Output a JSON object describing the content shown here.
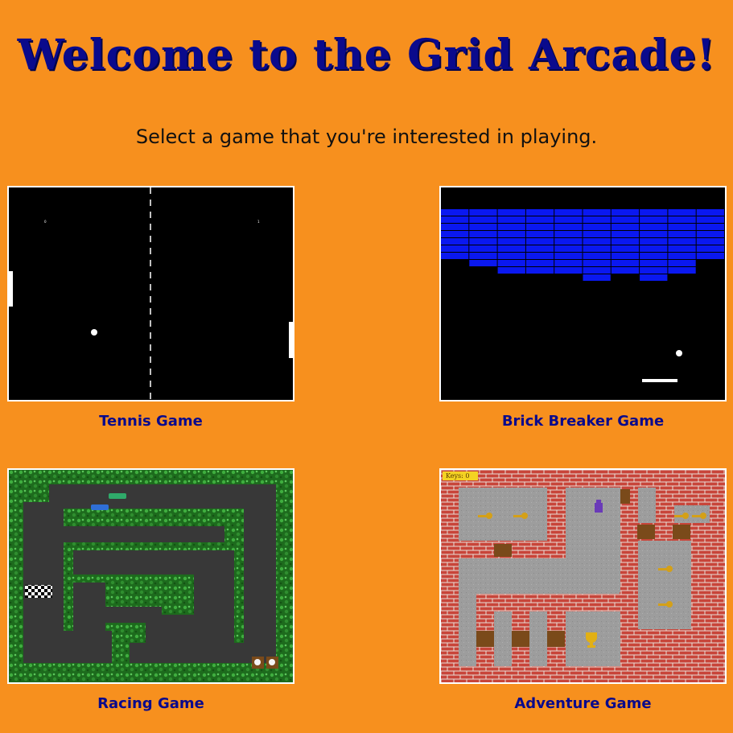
{
  "header": {
    "title": "Welcome to the Grid Arcade!",
    "subtitle": "Select a game that you're interested in playing."
  },
  "games": [
    {
      "id": "tennis",
      "label": "Tennis Game",
      "scores": [
        "0",
        "1"
      ]
    },
    {
      "id": "brick",
      "label": "Brick Breaker Game"
    },
    {
      "id": "racing",
      "label": "Racing Game"
    },
    {
      "id": "adventure",
      "label": "Adventure Game",
      "hud": "Keys: 0"
    }
  ],
  "colors": {
    "background": "#f7901e",
    "title": "#0a0a8c",
    "brick": "#0a18f0",
    "grass": "#1e6e1e",
    "track": "#3a3a3a",
    "wall": "#c0392b",
    "floor": "#9a9a9a"
  }
}
